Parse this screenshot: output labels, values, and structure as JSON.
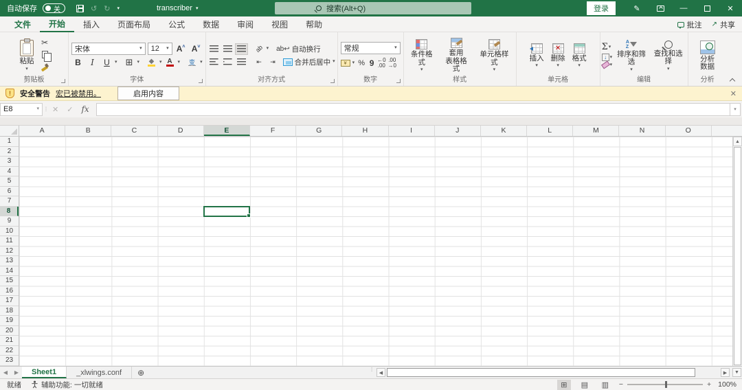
{
  "colors": {
    "brand_green": "#217346",
    "titlebar_bg": "#217346",
    "message_bar_bg": "#fdf3cf",
    "active_cell_border": "#217346"
  },
  "titlebar": {
    "autosave_label": "自动保存",
    "autosave_state": "关",
    "doc_title": "transcriber",
    "search_placeholder": "搜索(Alt+Q)",
    "signin_label": "登录"
  },
  "ribbon_tabs": {
    "items": [
      "文件",
      "开始",
      "插入",
      "页面布局",
      "公式",
      "数据",
      "审阅",
      "视图",
      "帮助"
    ],
    "active": "开始",
    "comments_label": "批注",
    "share_label": "共享"
  },
  "ribbon": {
    "clipboard": {
      "label": "剪贴板",
      "paste": "粘贴"
    },
    "font": {
      "label": "字体",
      "family": "宋体",
      "size": "12",
      "bold": "B",
      "italic": "I",
      "underline": "U",
      "phonetic": "变"
    },
    "alignment": {
      "label": "对齐方式",
      "wrap": "自动换行",
      "merge": "合并后居中",
      "orient": "ab"
    },
    "number": {
      "label": "数字",
      "format": "常规",
      "percent": "%",
      "comma": "9",
      "inc_dec": "←.0\n.00",
      "dec_dec": ".00\n→.0"
    },
    "styles": {
      "label": "样式",
      "conditional": "条件格式",
      "format_table": "套用\n表格格式",
      "cell_styles": "单元格样式"
    },
    "cells": {
      "label": "单元格",
      "insert": "插入",
      "delete": "删除",
      "format": "格式"
    },
    "editing": {
      "label": "编辑",
      "autosum": "Σ",
      "sort_filter": "排序和筛选",
      "find_select": "查找和选择"
    },
    "analysis": {
      "label": "分析",
      "analyze_data": "分析\n数据"
    }
  },
  "message_bar": {
    "title": "安全警告",
    "message": "宏已被禁用。",
    "action": "启用内容",
    "close": "✕"
  },
  "formula_bar": {
    "name_box": "E8",
    "cancel": "✕",
    "enter": "✓",
    "fx_label": "fx",
    "value": ""
  },
  "grid": {
    "columns": [
      "A",
      "B",
      "C",
      "D",
      "E",
      "F",
      "G",
      "H",
      "I",
      "J",
      "K",
      "L",
      "M",
      "N",
      "O"
    ],
    "rows": [
      "1",
      "2",
      "3",
      "4",
      "5",
      "6",
      "7",
      "8",
      "9",
      "10",
      "11",
      "12",
      "13",
      "14",
      "15",
      "16",
      "17",
      "18",
      "19",
      "20",
      "21",
      "22",
      "23"
    ],
    "selected_column": "E",
    "selected_row": "8"
  },
  "sheet_bar": {
    "tabs": [
      {
        "label": "Sheet1",
        "active": true
      },
      {
        "label": "_xlwings.conf",
        "active": false
      }
    ],
    "add_label": "⊕"
  },
  "status_bar": {
    "mode": "就绪",
    "accessibility": "辅助功能: 一切就绪",
    "zoom_level": "100%"
  }
}
